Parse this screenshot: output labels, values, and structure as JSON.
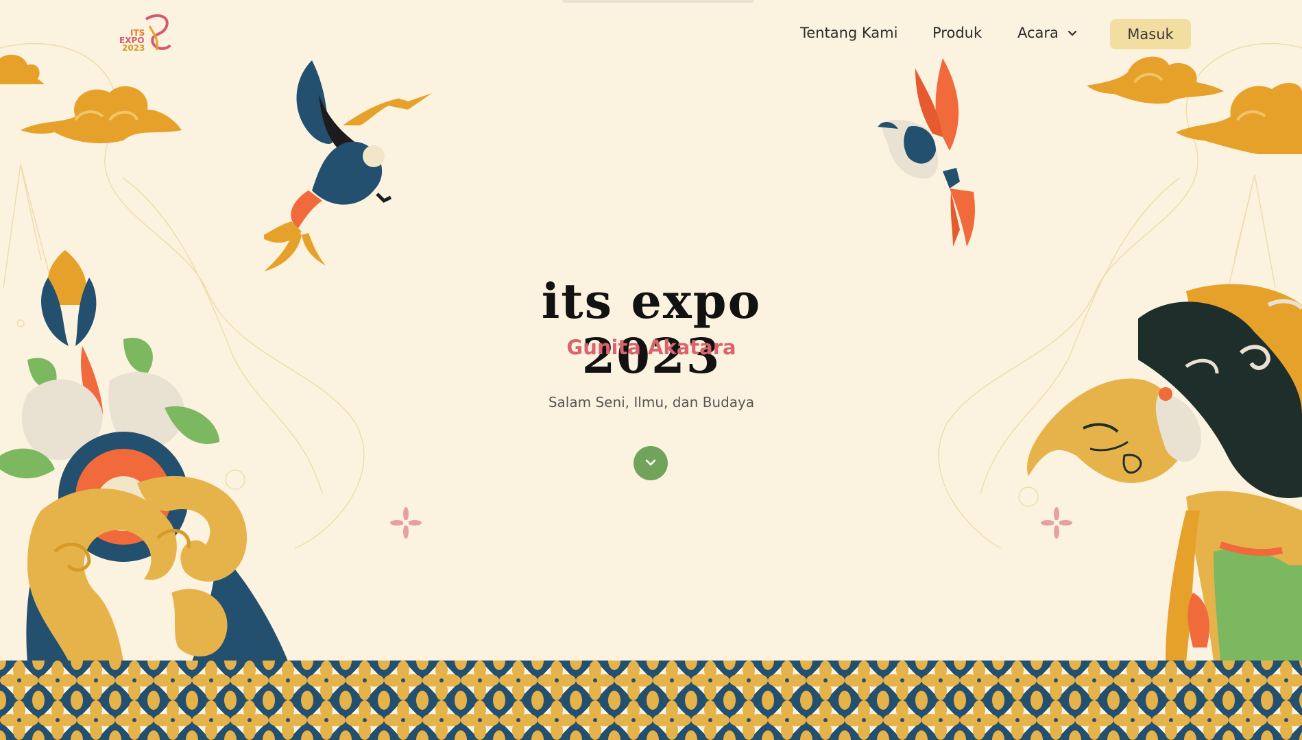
{
  "logo": {
    "line1": "ITS",
    "line2": "EXPO",
    "line3": "2023"
  },
  "nav": {
    "items": [
      {
        "label": "Tentang Kami"
      },
      {
        "label": "Produk"
      },
      {
        "label": "Acara"
      }
    ],
    "login_label": "Masuk"
  },
  "hero": {
    "title": "its expo 2023",
    "subtitle": "Gunita Akatara",
    "tagline": "Salam Seni, Ilmu, dan Budaya"
  },
  "icons": {
    "dropdown": "chevron-down-icon",
    "scroll": "chevron-down-icon"
  },
  "colors": {
    "background": "#fbf3df",
    "login_button": "#f3dea2",
    "subtitle": "#d9646e",
    "scroll_button": "#72a35a",
    "gold": "#e6a12a",
    "navy": "#23506e",
    "orange": "#f06a3c",
    "green": "#7cb860"
  }
}
